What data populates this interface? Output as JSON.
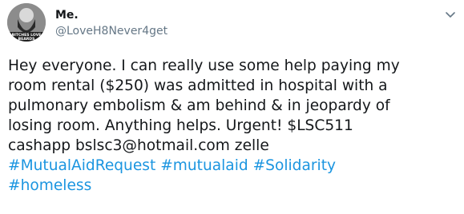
{
  "author": {
    "display_name": "Me.",
    "handle": "@LoveH8Never4get",
    "avatar_caption_line1": "BITCHES LOVE",
    "avatar_caption_line2": "BEARDS"
  },
  "tweet": {
    "text_lines": [
      "Hey everyone. I can really use some help paying my",
      "room rental ($250) was admitted in hospital with a",
      "pulmonary embolism & am behind & in jeopardy of",
      "losing room. Anything helps. Urgent! $LSC511",
      "cashapp bslsc3@hotmail.com zelle"
    ],
    "hashtags": [
      "#MutualAidRequest",
      "#mutualaid",
      "#Solidarity",
      "#homeless"
    ]
  },
  "icons": {
    "menu": "chevron-down-icon"
  },
  "colors": {
    "text": "#14171a",
    "secondary": "#657786",
    "link": "#1b95e0"
  }
}
